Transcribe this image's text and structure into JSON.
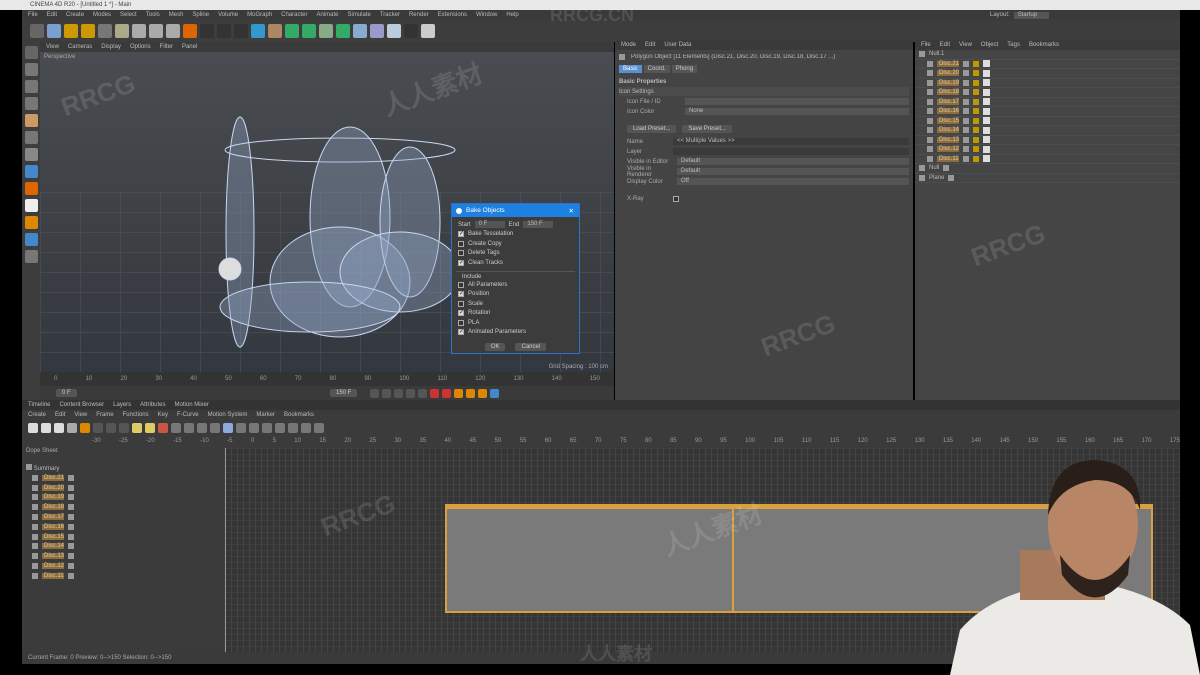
{
  "title": "CINEMA 4D R20 - [Untitled 1 *] - Main",
  "menu": [
    "File",
    "Edit",
    "Create",
    "Modes",
    "Select",
    "Tools",
    "Mesh",
    "Spline",
    "Volume",
    "MoGraph",
    "Character",
    "Animate",
    "Simulate",
    "Tracker",
    "Render",
    "Extensions",
    "Window",
    "Help"
  ],
  "layout": {
    "label": "Layout:",
    "value": "Startup"
  },
  "viewport": {
    "menu": [
      "View",
      "Cameras",
      "Display",
      "Options",
      "Filter",
      "Panel"
    ],
    "label": "Perspective",
    "grid_spacing": "Grid Spacing : 100 cm"
  },
  "ruler": [
    "0",
    "10",
    "20",
    "30",
    "40",
    "50",
    "60",
    "70",
    "80",
    "90",
    "100",
    "110",
    "120",
    "130",
    "140",
    "150"
  ],
  "frames": {
    "start": "0 F",
    "end": "150 F"
  },
  "attr": {
    "menu": [
      "Mode",
      "Edit",
      "User Data"
    ],
    "object_title": "Polygon Object [11 Elements] (Disc.21, Disc.20, Disc.19, Disc.18, Disc.17 ...)",
    "tabs": [
      "Basic",
      "Coord.",
      "Phong"
    ],
    "section": "Basic Properties",
    "subsection": "Icon Settings",
    "icon_file": "Icon File / ID",
    "icon_color": "Icon Color",
    "icon_color_val": "None",
    "load_preset": "Load Preset...",
    "save_preset": "Save Preset...",
    "name_label": "Name",
    "name_val": "<< Multiple Values >>",
    "layer_label": "Layer",
    "vis_editor": "Visible in Editor",
    "vis_editor_val": "Default",
    "vis_render": "Visible in Renderer",
    "vis_render_val": "Default",
    "display_color": "Display Color",
    "display_color_val": "Off",
    "xray": "X-Ray"
  },
  "objects": {
    "menu": [
      "File",
      "Edit",
      "View",
      "Object",
      "Tags",
      "Bookmarks"
    ],
    "root": "Null.1",
    "items": [
      "Disc.21",
      "Disc.20",
      "Disc.19",
      "Disc.18",
      "Disc.17",
      "Disc.16",
      "Disc.15",
      "Disc.14",
      "Disc.13",
      "Disc.12",
      "Disc.11"
    ],
    "extra": [
      "Null",
      "Plane"
    ]
  },
  "dialog": {
    "title": "Bake Objects",
    "start_label": "Start",
    "start": "0 F",
    "end_label": "End",
    "end": "150 F",
    "options": [
      {
        "label": "Bake Tesselation",
        "on": true
      },
      {
        "label": "Create Copy",
        "on": false
      },
      {
        "label": "Delete Tags",
        "on": false
      },
      {
        "label": "Clean Tracks",
        "on": true
      }
    ],
    "include_label": "Include",
    "include": [
      {
        "label": "All Parameters",
        "on": false
      },
      {
        "label": "Position",
        "on": true
      },
      {
        "label": "Scale",
        "on": false
      },
      {
        "label": "Rotation",
        "on": true
      },
      {
        "label": "PLA",
        "on": false
      },
      {
        "label": "Animated Parameters",
        "on": true
      }
    ],
    "ok": "OK",
    "cancel": "Cancel"
  },
  "timeline": {
    "tabs": [
      "Timeline",
      "Content Browser",
      "Layers",
      "Attributes",
      "Motion Mixer"
    ],
    "menu": [
      "Create",
      "Edit",
      "View",
      "Frame",
      "Functions",
      "Key",
      "F-Curve",
      "Motion System",
      "Marker",
      "Bookmarks"
    ],
    "ruler": [
      "-30",
      "-25",
      "-20",
      "-15",
      "-10",
      "-5",
      "0",
      "5",
      "10",
      "15",
      "20",
      "25",
      "30",
      "35",
      "40",
      "45",
      "50",
      "55",
      "60",
      "65",
      "70",
      "75",
      "80",
      "85",
      "90",
      "95",
      "100",
      "105",
      "110",
      "115",
      "120",
      "125",
      "130",
      "135",
      "140",
      "145",
      "150",
      "155",
      "160",
      "165",
      "170",
      "175"
    ],
    "mode": "Dope Sheet",
    "group": "Summary",
    "items": [
      "Disc.21",
      "Disc.20",
      "Disc.19",
      "Disc.18",
      "Disc.17",
      "Disc.16",
      "Disc.15",
      "Disc.14",
      "Disc.13",
      "Disc.12",
      "Disc.11"
    ]
  },
  "status": "Current Frame: 0   Preview: 0-->150   Selection: 0-->150",
  "watermark": [
    "RRCG",
    "人人素材",
    "RRCG.CN"
  ]
}
